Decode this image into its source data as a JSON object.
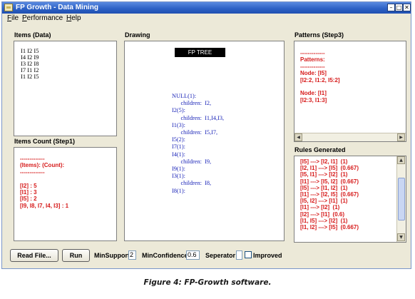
{
  "window": {
    "title": "FP Growth - Data Mining"
  },
  "menu": [
    {
      "label": "File",
      "mnemonic": "F",
      "rest": "ile"
    },
    {
      "label": "Performance",
      "mnemonic": "P",
      "rest": "erformance"
    },
    {
      "label": "Help",
      "mnemonic": "H",
      "rest": "elp"
    }
  ],
  "items_panel": {
    "title": "Items (Data)",
    "lines": [
      "I1 I2 I5",
      "I4 I2 I9",
      "I3 I2 I8",
      "I7 I1 I2",
      "I1 I2 I5"
    ]
  },
  "items_count_panel": {
    "title": "Items Count (Step1)",
    "text": "-------------\n(Items): (Count):\n-------------\n\n[I2] : 5\n[I1] : 3\n[I5] : 2\n[I9, I8, I7, I4, I3] : 1"
  },
  "drawing_panel": {
    "title": "Drawing",
    "tree_label": "FP TREE",
    "tree_text": "NULL(1):\n      children:  I2,\nI2(5):\n      children:  I1,I4,I3,\nI1(3):\n      children:  I5,I7,\nI5(2):\nI7(1):\nI4(1):\n      children:  I9,\nI9(1):\nI3(1):\n      children:  I8,\nI8(1):"
  },
  "patterns_panel": {
    "title": "Patterns (Step3)",
    "text": "-------------\nPatterns:\n-------------\nNode: [I5]\n[I2:2, I1:2, I5:2]\n\nNode: [I1]\n[I2:3, I1:3]"
  },
  "rules_panel": {
    "title": "Rules Generated",
    "text": "[I5] ---> [I2, I1]  (1)\n[I2, I1] ---> [I5]  (0.667)\n[I5, I1] ---> [I2]  (1)\n[I1] ---> [I5, I2]  (0.667)\n[I5] ---> [I1, I2]  (1)\n[I1] ---> [I2, I5]  (0.667)\n[I5, I2] ---> [I1]  (1)\n[I1] ---> [I2]  (1)\n[I2] ---> [I1]  (0.6)\n[I1, I5] ---> [I2]  (1)\n[I1, I2] ---> [I5]  (0.667)"
  },
  "controls": {
    "read_file": "Read File...",
    "run": "Run",
    "min_support_label": "MinSupport:",
    "min_support_value": "2",
    "min_confidence_label": "MinConfidence:",
    "min_confidence_value": "0.6",
    "separator_label": "Seperator",
    "separator_value": "",
    "improved_label": "Improved",
    "improved_checked": false
  },
  "caption": "Figure 4: FP-Growth software."
}
